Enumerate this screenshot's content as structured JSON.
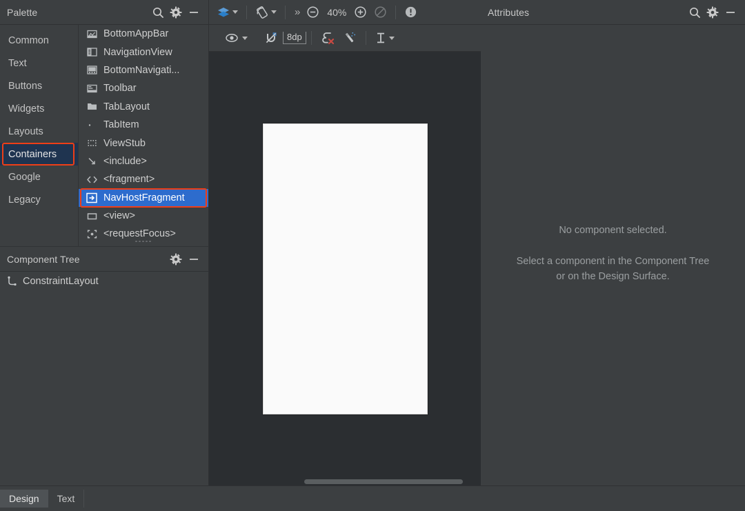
{
  "palette": {
    "title": "Palette",
    "header_icons": [
      {
        "name": "search-icon",
        "glyph": "search"
      },
      {
        "name": "gear-icon",
        "glyph": "gear"
      },
      {
        "name": "minimize-icon",
        "glyph": "minus"
      }
    ],
    "categories": [
      {
        "label": "Common",
        "selected": false
      },
      {
        "label": "Text",
        "selected": false
      },
      {
        "label": "Buttons",
        "selected": false
      },
      {
        "label": "Widgets",
        "selected": false
      },
      {
        "label": "Layouts",
        "selected": false
      },
      {
        "label": "Containers",
        "selected": true,
        "annotated": true
      },
      {
        "label": "Google",
        "selected": false
      },
      {
        "label": "Legacy",
        "selected": false
      }
    ],
    "items": [
      {
        "label": "BottomAppBar",
        "icon": "bottom-app-bar-icon",
        "selected": false
      },
      {
        "label": "NavigationView",
        "icon": "navigation-view-icon",
        "selected": false
      },
      {
        "label": "BottomNavigati...",
        "icon": "bottom-navigation-view-icon",
        "selected": false
      },
      {
        "label": "Toolbar",
        "icon": "toolbar-icon",
        "selected": false
      },
      {
        "label": "TabLayout",
        "icon": "tab-layout-icon",
        "selected": false
      },
      {
        "label": "TabItem",
        "icon": "tab-item-icon",
        "selected": false
      },
      {
        "label": "ViewStub",
        "icon": "view-stub-icon",
        "selected": false
      },
      {
        "label": "<include>",
        "icon": "include-icon",
        "selected": false
      },
      {
        "label": "<fragment>",
        "icon": "fragment-icon",
        "selected": false
      },
      {
        "label": "NavHostFragment",
        "icon": "nav-host-fragment-icon",
        "selected": true,
        "annotated": true
      },
      {
        "label": "<view>",
        "icon": "view-icon",
        "selected": false
      },
      {
        "label": "<requestFocus>",
        "icon": "request-focus-icon",
        "selected": false
      }
    ]
  },
  "component_tree": {
    "title": "Component Tree",
    "header_icons": [
      {
        "name": "gear-icon",
        "glyph": "gear"
      },
      {
        "name": "minimize-icon",
        "glyph": "minus"
      }
    ],
    "nodes": [
      {
        "label": "ConstraintLayout",
        "icon": "constraint-layout-icon"
      }
    ]
  },
  "design_surface": {
    "toolbar": {
      "design_mode_label": "Design surface mode",
      "orientation_label": "Orientation / device configuration",
      "overflow_label": "»",
      "zoom_out_label": "Zoom out",
      "zoom_level": "40%",
      "zoom_in_label": "Zoom in",
      "zoom_to_fit_label": "Zoom to fit",
      "issues_label": "Warnings and errors"
    },
    "constraints_toolbar": {
      "view_options_label": "View options",
      "autoconnect_label": "Turn on Autoconnect",
      "default_margin": "8dp",
      "clear_constraints_label": "Clear all constraints",
      "infer_constraints_label": "Infer constraints",
      "align_label": "Align"
    }
  },
  "attributes": {
    "title": "Attributes",
    "header_icons": [
      {
        "name": "search-icon",
        "glyph": "search"
      },
      {
        "name": "gear-icon",
        "glyph": "gear"
      },
      {
        "name": "minimize-icon",
        "glyph": "minus"
      }
    ],
    "empty_primary": "No component selected.",
    "empty_secondary": "Select a component in the Component Tree or on the Design Surface."
  },
  "bottom_tabs": [
    {
      "label": "Design",
      "active": true
    },
    {
      "label": "Text",
      "active": false
    }
  ],
  "colors": {
    "panel_bg": "#3c3f41",
    "canvas_bg": "#2b2e31",
    "selection_blue": "#2d6ccd",
    "category_selected_bg": "#1f3450",
    "annotation_red": "#ef3e17",
    "device_white": "#fafafa",
    "text": "#cfcfcf"
  }
}
